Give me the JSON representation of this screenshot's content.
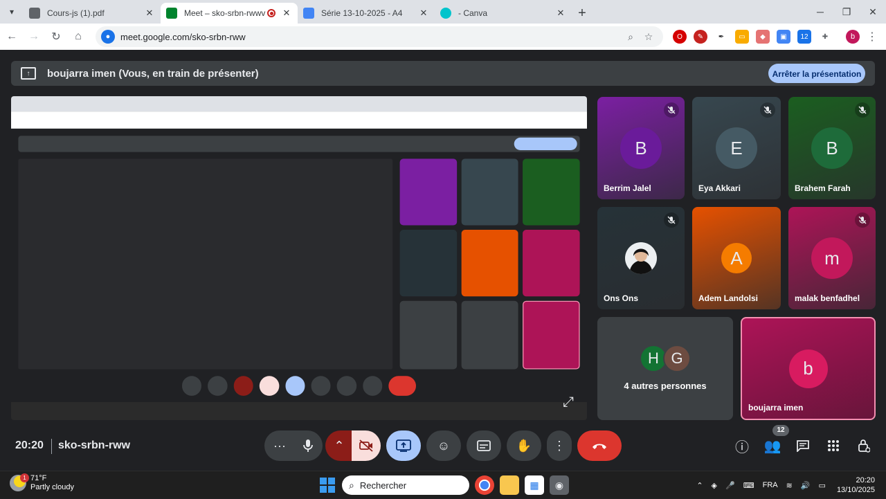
{
  "browser": {
    "tabs": [
      {
        "title": "Cours-js (1).pdf",
        "color": "#5f6368"
      },
      {
        "title": "Meet – sko-srbn-rwwv",
        "color": "#1a73e8",
        "recording": true
      },
      {
        "title": "Série 13-10-2025 - A4",
        "color": "#4285f4"
      },
      {
        "title": "- Canva",
        "color": "#00c4cc"
      }
    ],
    "url": "meet.google.com/sko-srbn-rww",
    "extensions_badge": "12",
    "profile_initial": "b"
  },
  "meet": {
    "presenting_text": "boujarra imen (Vous, en train de présenter)",
    "stop_presenting": "Arrêter la présentation",
    "participants": [
      {
        "name": "Berrim Jalel",
        "initial": "B",
        "bg": "#7b1fa2",
        "avatar_bg": "#6a1b9a",
        "muted": true
      },
      {
        "name": "Eya Akkari",
        "initial": "E",
        "bg": "#37474f",
        "avatar_bg": "#455a64",
        "muted": true
      },
      {
        "name": "Brahem Farah",
        "initial": "B",
        "bg": "#1b5e20",
        "avatar_bg": "#1e6b3a",
        "muted": true
      },
      {
        "name": "Ons Ons",
        "initial": "",
        "bg": "#263238",
        "avatar_bg": "#eceff1",
        "muted": true
      },
      {
        "name": "Adem Landolsi",
        "initial": "A",
        "bg": "#e65100",
        "avatar_bg": "#f57c00",
        "muted": false
      },
      {
        "name": "malak benfadhel",
        "initial": "m",
        "bg": "#ad1457",
        "avatar_bg": "#c2185b",
        "muted": true
      }
    ],
    "others": {
      "label": "4 autres personnes",
      "a": "H",
      "b": "G",
      "a_bg": "#137333",
      "b_bg": "#6d4c41"
    },
    "self": {
      "name": "boujarra imen",
      "initial": "b",
      "bg": "#ad1457",
      "avatar_bg": "#d81b60"
    },
    "time": "20:20",
    "code": "sko-srbn-rww",
    "people_count": "12",
    "colors": {
      "end_call": "#dc362e",
      "present_active": "#a8c7fa",
      "cam_off": "#f9dedc"
    }
  },
  "taskbar": {
    "temp": "71°F",
    "weather": "Partly cloudy",
    "weather_badge": "1",
    "search": "Rechercher",
    "lang": "FRA",
    "time": "20:20",
    "date": "13/10/2025"
  }
}
